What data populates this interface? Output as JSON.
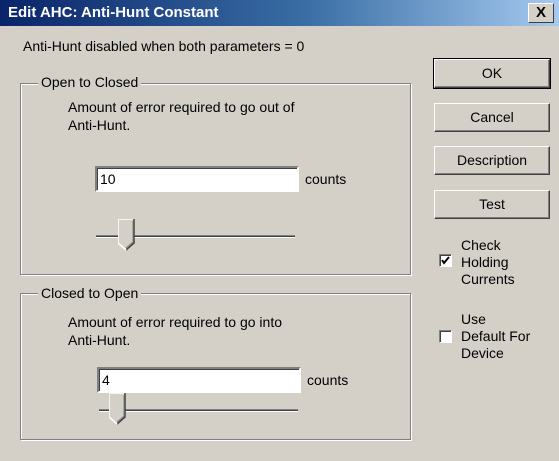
{
  "window": {
    "title": "Edit AHC: Anti-Hunt Constant",
    "close_label": "X"
  },
  "info_text": "Anti-Hunt disabled when both parameters = 0",
  "open_to_closed": {
    "group_label": "Open to Closed",
    "description_line1": "Amount of error required to go out of",
    "description_line2": "Anti-Hunt.",
    "value": "10",
    "unit": "counts",
    "slider_position": 0.1
  },
  "closed_to_open": {
    "group_label": "Closed to Open",
    "description_line1": "Amount of error required to go into",
    "description_line2": "Anti-Hunt.",
    "value": "4",
    "unit": "counts",
    "slider_position": 0.04
  },
  "buttons": {
    "ok": "OK",
    "cancel": "Cancel",
    "description": "Description",
    "test": "Test"
  },
  "check_holding": {
    "line1": "Check",
    "line2": "Holding",
    "line3": "Currents",
    "checked": true
  },
  "use_default": {
    "line1": "Use",
    "line2": "Default For",
    "line3": "Device",
    "checked": false
  }
}
